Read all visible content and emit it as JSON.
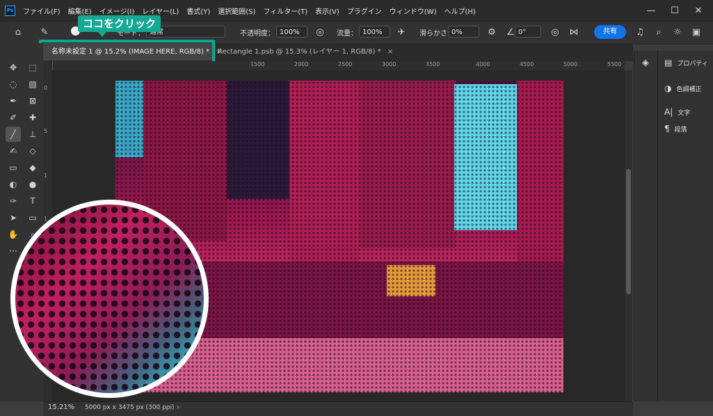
{
  "app": {
    "logo": "Ps"
  },
  "menu": [
    "ファイル(F)",
    "編集(E)",
    "イメージ(I)",
    "レイヤー(L)",
    "書式(Y)",
    "選択範囲(S)",
    "フィルター(T)",
    "表示(V)",
    "プラグイン",
    "ウィンドウ(W)",
    "ヘルプ(H)"
  ],
  "window_controls": {
    "minimize": "—",
    "maximize": "☐",
    "close": "✕"
  },
  "options": {
    "mode_label": "モード：",
    "mode_value": "通常",
    "opacity_label": "不透明度：",
    "opacity_value": "100%",
    "flow_label": "流量：",
    "flow_value": "100%",
    "smoothing_label": "滑らかさ：",
    "smoothing_value": "0%",
    "angle_value": "0°",
    "share_label": "共有"
  },
  "callout": {
    "text": "ココをクリック"
  },
  "tabs": [
    {
      "label": "名称未設定 1 @ 15.2% (IMAGE HERE, RGB/8) *",
      "close": "×",
      "active": true
    },
    {
      "label": "Rectangle 1.psb @ 15.3% (レイヤー 1, RGB/8) *",
      "close": "×",
      "active": false
    }
  ],
  "ruler_top": [
    "1500",
    "2000",
    "2500",
    "3000",
    "3500",
    "4000",
    "4500",
    "5000",
    "5500"
  ],
  "ruler_left": [
    "0",
    "5",
    "1",
    "1",
    "2"
  ],
  "panels": [
    {
      "icon": "properties-icon",
      "label": "プロパティ"
    },
    {
      "icon": "adjustments-icon",
      "label": "色調補正"
    },
    {
      "icon": "character-icon",
      "label": "文字"
    },
    {
      "icon": "paragraph-icon",
      "label": "段落"
    }
  ],
  "status": {
    "zoom": "15.21%",
    "doc_info": "5000 px x 3475 px (300 ppi)"
  },
  "colors": {
    "accent": "#1473e6",
    "callout": "#15a893",
    "tab_highlight": "#0ea58f"
  }
}
